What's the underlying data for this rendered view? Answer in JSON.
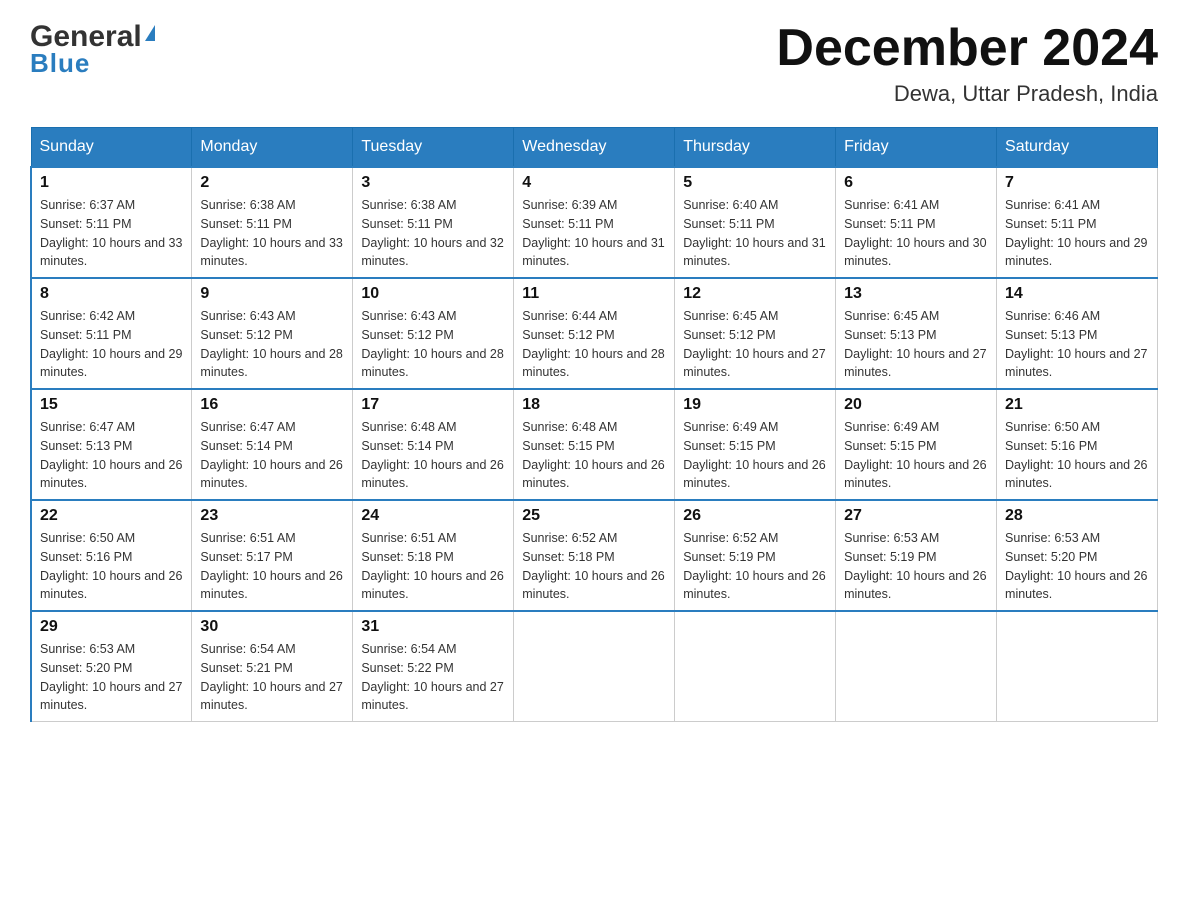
{
  "logo": {
    "text_black": "General",
    "triangle_symbol": "▶",
    "text_blue": "Blue"
  },
  "header": {
    "month_title": "December 2024",
    "location": "Dewa, Uttar Pradesh, India"
  },
  "days_of_week": [
    "Sunday",
    "Monday",
    "Tuesday",
    "Wednesday",
    "Thursday",
    "Friday",
    "Saturday"
  ],
  "weeks": [
    [
      {
        "day": "1",
        "sunrise": "6:37 AM",
        "sunset": "5:11 PM",
        "daylight": "10 hours and 33 minutes."
      },
      {
        "day": "2",
        "sunrise": "6:38 AM",
        "sunset": "5:11 PM",
        "daylight": "10 hours and 33 minutes."
      },
      {
        "day": "3",
        "sunrise": "6:38 AM",
        "sunset": "5:11 PM",
        "daylight": "10 hours and 32 minutes."
      },
      {
        "day": "4",
        "sunrise": "6:39 AM",
        "sunset": "5:11 PM",
        "daylight": "10 hours and 31 minutes."
      },
      {
        "day": "5",
        "sunrise": "6:40 AM",
        "sunset": "5:11 PM",
        "daylight": "10 hours and 31 minutes."
      },
      {
        "day": "6",
        "sunrise": "6:41 AM",
        "sunset": "5:11 PM",
        "daylight": "10 hours and 30 minutes."
      },
      {
        "day": "7",
        "sunrise": "6:41 AM",
        "sunset": "5:11 PM",
        "daylight": "10 hours and 29 minutes."
      }
    ],
    [
      {
        "day": "8",
        "sunrise": "6:42 AM",
        "sunset": "5:11 PM",
        "daylight": "10 hours and 29 minutes."
      },
      {
        "day": "9",
        "sunrise": "6:43 AM",
        "sunset": "5:12 PM",
        "daylight": "10 hours and 28 minutes."
      },
      {
        "day": "10",
        "sunrise": "6:43 AM",
        "sunset": "5:12 PM",
        "daylight": "10 hours and 28 minutes."
      },
      {
        "day": "11",
        "sunrise": "6:44 AM",
        "sunset": "5:12 PM",
        "daylight": "10 hours and 28 minutes."
      },
      {
        "day": "12",
        "sunrise": "6:45 AM",
        "sunset": "5:12 PM",
        "daylight": "10 hours and 27 minutes."
      },
      {
        "day": "13",
        "sunrise": "6:45 AM",
        "sunset": "5:13 PM",
        "daylight": "10 hours and 27 minutes."
      },
      {
        "day": "14",
        "sunrise": "6:46 AM",
        "sunset": "5:13 PM",
        "daylight": "10 hours and 27 minutes."
      }
    ],
    [
      {
        "day": "15",
        "sunrise": "6:47 AM",
        "sunset": "5:13 PM",
        "daylight": "10 hours and 26 minutes."
      },
      {
        "day": "16",
        "sunrise": "6:47 AM",
        "sunset": "5:14 PM",
        "daylight": "10 hours and 26 minutes."
      },
      {
        "day": "17",
        "sunrise": "6:48 AM",
        "sunset": "5:14 PM",
        "daylight": "10 hours and 26 minutes."
      },
      {
        "day": "18",
        "sunrise": "6:48 AM",
        "sunset": "5:15 PM",
        "daylight": "10 hours and 26 minutes."
      },
      {
        "day": "19",
        "sunrise": "6:49 AM",
        "sunset": "5:15 PM",
        "daylight": "10 hours and 26 minutes."
      },
      {
        "day": "20",
        "sunrise": "6:49 AM",
        "sunset": "5:15 PM",
        "daylight": "10 hours and 26 minutes."
      },
      {
        "day": "21",
        "sunrise": "6:50 AM",
        "sunset": "5:16 PM",
        "daylight": "10 hours and 26 minutes."
      }
    ],
    [
      {
        "day": "22",
        "sunrise": "6:50 AM",
        "sunset": "5:16 PM",
        "daylight": "10 hours and 26 minutes."
      },
      {
        "day": "23",
        "sunrise": "6:51 AM",
        "sunset": "5:17 PM",
        "daylight": "10 hours and 26 minutes."
      },
      {
        "day": "24",
        "sunrise": "6:51 AM",
        "sunset": "5:18 PM",
        "daylight": "10 hours and 26 minutes."
      },
      {
        "day": "25",
        "sunrise": "6:52 AM",
        "sunset": "5:18 PM",
        "daylight": "10 hours and 26 minutes."
      },
      {
        "day": "26",
        "sunrise": "6:52 AM",
        "sunset": "5:19 PM",
        "daylight": "10 hours and 26 minutes."
      },
      {
        "day": "27",
        "sunrise": "6:53 AM",
        "sunset": "5:19 PM",
        "daylight": "10 hours and 26 minutes."
      },
      {
        "day": "28",
        "sunrise": "6:53 AM",
        "sunset": "5:20 PM",
        "daylight": "10 hours and 26 minutes."
      }
    ],
    [
      {
        "day": "29",
        "sunrise": "6:53 AM",
        "sunset": "5:20 PM",
        "daylight": "10 hours and 27 minutes."
      },
      {
        "day": "30",
        "sunrise": "6:54 AM",
        "sunset": "5:21 PM",
        "daylight": "10 hours and 27 minutes."
      },
      {
        "day": "31",
        "sunrise": "6:54 AM",
        "sunset": "5:22 PM",
        "daylight": "10 hours and 27 minutes."
      },
      null,
      null,
      null,
      null
    ]
  ],
  "labels": {
    "sunrise": "Sunrise:",
    "sunset": "Sunset:",
    "daylight": "Daylight:"
  },
  "accent_color": "#2a7dbf"
}
